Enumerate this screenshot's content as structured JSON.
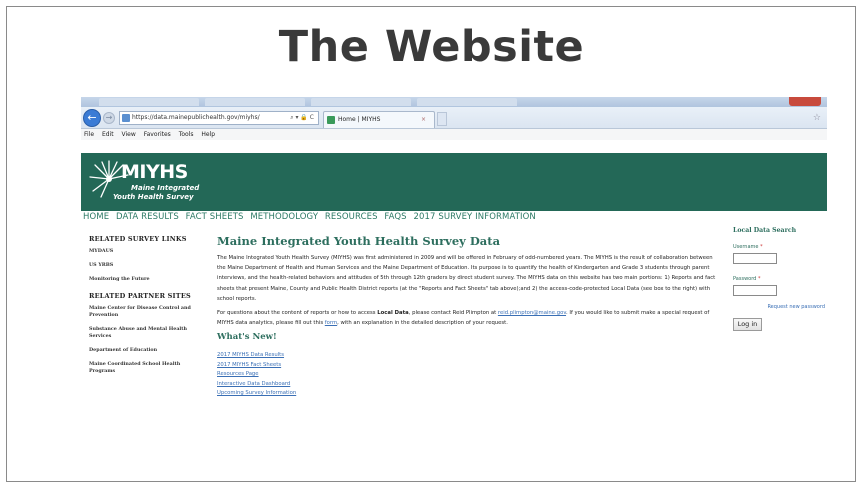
{
  "slide": {
    "title": "The Website"
  },
  "browser": {
    "url": "https://data.mainepublichealth.gov/miyhs/",
    "url_controls": "⌕ ▾ 🔒 C",
    "tab_title": "Home | MIYHS",
    "tab_close": "×",
    "back_glyph": "←",
    "forward_glyph": "→",
    "menu": [
      "File",
      "Edit",
      "View",
      "Favorites",
      "Tools",
      "Help"
    ]
  },
  "site": {
    "logo": {
      "title": "MIYHS",
      "sub1": "Maine Integrated",
      "sub2": "Youth Health Survey"
    },
    "nav": [
      "HOME",
      "DATA RESULTS",
      "FACT SHEETS",
      "METHODOLOGY",
      "RESOURCES",
      "FAQS",
      "2017 SURVEY INFORMATION"
    ]
  },
  "sidebar": {
    "related_survey_heading": "RELATED SURVEY LINKS",
    "related_survey_links": [
      "MYDAUS",
      "US YRBS",
      "Monitoring the Future"
    ],
    "partner_heading": "RELATED PARTNER SITES",
    "partner_links": [
      "Maine Center for Disease Control and Prevention",
      "Substance Abuse and Mental Health Services",
      "Department of Education",
      "Maine Coordinated School Health Programs"
    ]
  },
  "main": {
    "title": "Maine Integrated Youth Health Survey Data",
    "para1": "The Maine Integrated Youth Health Survey (MIYHS) was first administered in 2009 and will be offered in February of odd-numbered years. The MIYHS is the result of collaboration between the Maine Department of Health and Human Services and the Maine Department of Education. Its purpose is to quantify the health of Kindergarten and Grade 3 students through parent interviews, and the health-related behaviors and attitudes of 5th through 12th graders by direct student survey. The MIYHS data on this website has two main portions: 1) Reports and fact sheets that present Maine, County and Public Health District reports (at the \"Reports and Fact Sheets\" tab above);and 2) the access-code-protected Local Data (see box to the right) with school reports.",
    "para2_a": "For questions about the content of reports or how to access",
    "para2_bold": "Local Data",
    "para2_b": ", please contact Reid Plimpton at",
    "para2_email": "reid.plimpton@maine.gov",
    "para2_c": ". If you would like to submit make a special request of MIYHS data analytics, please fill out this",
    "para2_form": "form",
    "para2_d": ", with an explanation in the detailed description of your request.",
    "whats_new_heading": "What's New!",
    "whats_new_links": [
      "2017 MIYHS Data Results",
      "2017 MIYHS Fact Sheets",
      "Resources Page",
      "Interactive Data Dashboard",
      "Upcoming Survey Information"
    ]
  },
  "login": {
    "title": "Local Data Search",
    "username_label": "Username",
    "password_label": "Password",
    "required_mark": "*",
    "reset_link": "Request new password",
    "submit_label": "Log in"
  },
  "colors": {
    "header_green": "#236857",
    "link_blue": "#3a6fb5",
    "title_green": "#2d6e5e"
  }
}
